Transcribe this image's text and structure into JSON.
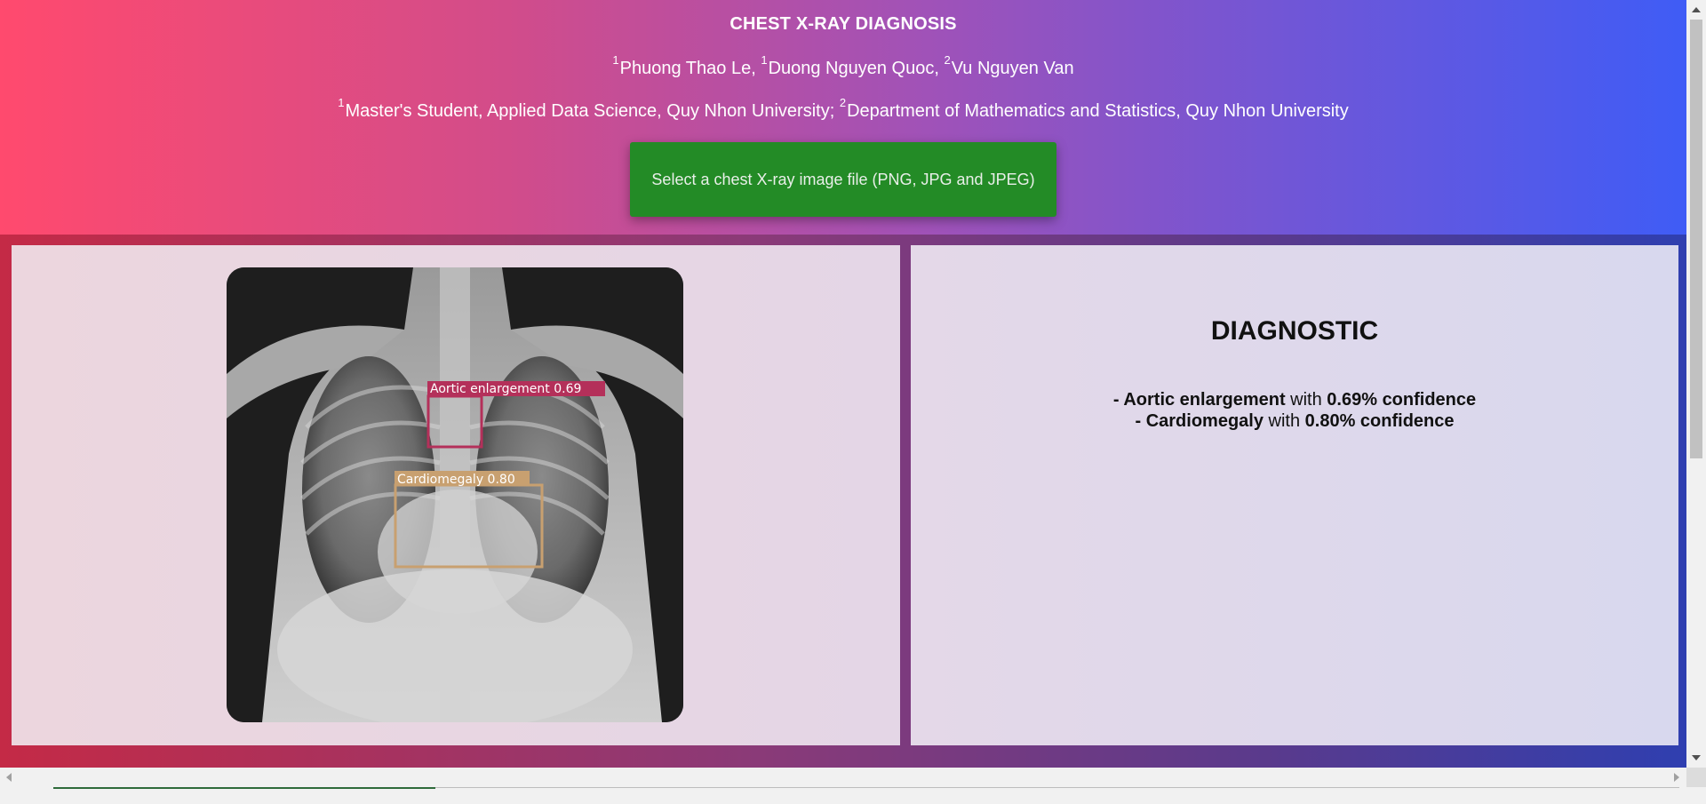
{
  "header": {
    "title": "CHEST X-RAY DIAGNOSIS",
    "authors": [
      {
        "sup": "1",
        "name": "Phuong Thao Le,"
      },
      {
        "sup": "1",
        "name": "Duong Nguyen Quoc,"
      },
      {
        "sup": "2",
        "name": "Vu Nguyen Van"
      }
    ],
    "affiliations": [
      {
        "sup": "1",
        "text": "Master's Student, Applied Data Science, Quy Nhon University;"
      },
      {
        "sup": "2",
        "text": "Department of Mathematics and Statistics, Quy Nhon University"
      }
    ],
    "upload_label": "Select a chest X-ray image file (PNG, JPG and JPEG)"
  },
  "xray": {
    "detections": [
      {
        "label": "Aortic enlargement 0.69",
        "color": "#b4305a"
      },
      {
        "label": "Cardiomegaly 0.80",
        "color": "#c8a070"
      }
    ]
  },
  "diagnostic": {
    "title": "DIAGNOSTIC",
    "items": [
      {
        "prefix": "- ",
        "finding": "Aortic enlargement",
        "mid": " with ",
        "conf": "0.69% confidence"
      },
      {
        "prefix": "- ",
        "finding": "Cardiomegaly",
        "mid": " with ",
        "conf": "0.80% confidence"
      }
    ]
  },
  "colors": {
    "upload_button": "#238b26",
    "header_start": "#ff4a6e",
    "header_end": "#3f5cf6"
  }
}
